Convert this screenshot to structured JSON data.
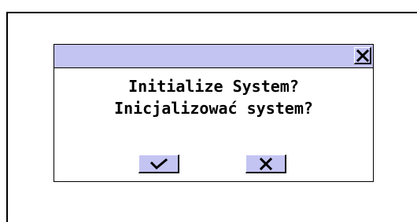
{
  "dialog": {
    "message_line1": "Initialize System?",
    "message_line2": "Inicjalizować system?",
    "confirm_icon": "checkmark-icon",
    "cancel_icon": "x-icon",
    "close_icon": "close-icon"
  },
  "colors": {
    "titlebar": "#c4c4f2",
    "button": "#c4c4f2",
    "border": "#000000",
    "background": "#ffffff"
  }
}
